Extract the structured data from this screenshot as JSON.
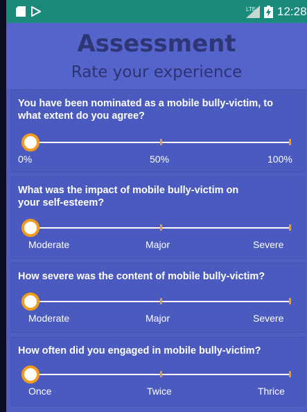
{
  "status_bar": {
    "network": "LTE",
    "time": "12:28"
  },
  "header": {
    "title": "Assessment",
    "subtitle": "Rate your experience"
  },
  "questions": [
    {
      "text": "You have been nominated as a mobile bully-victim, to what extent do you agree?",
      "labels": [
        "0%",
        "50%",
        "100%"
      ],
      "value": 0
    },
    {
      "text": "What was the impact of mobile bully-victim on your self-esteem?",
      "labels": [
        "Moderate",
        "Major",
        "Severe"
      ],
      "value": 0
    },
    {
      "text": "How severe was the content of mobile bully-victim?",
      "labels": [
        "Moderate",
        "Major",
        "Severe"
      ],
      "value": 0
    },
    {
      "text": "How often did you engaged in mobile bully-victim?",
      "labels": [
        "Once",
        "Twice",
        "Thrice"
      ],
      "value": 0
    }
  ],
  "colors": {
    "accent": "#f39b1a",
    "status_bar": "#1a8a7b",
    "background": "#4f5ec3",
    "title": "#2e3675"
  }
}
